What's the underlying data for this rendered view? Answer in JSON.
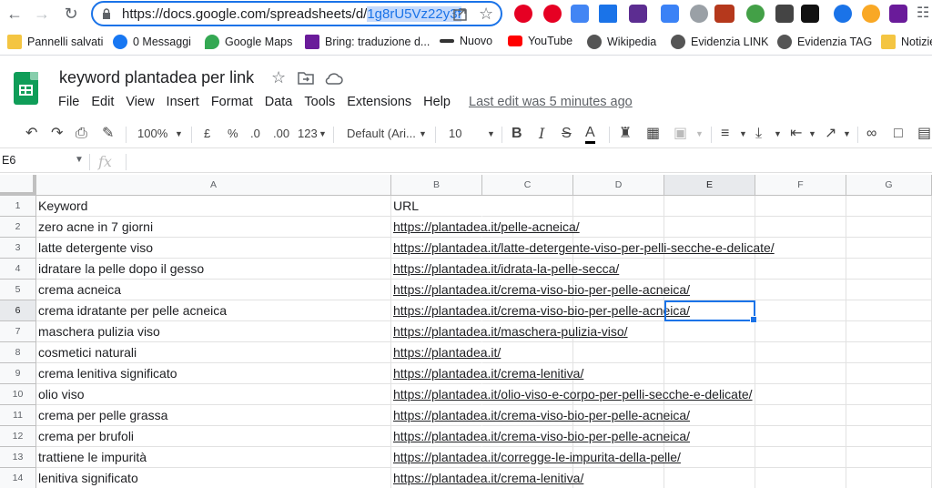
{
  "browser": {
    "url_prefix": "https://docs.google.com/spreadsheets/d/",
    "url_selected": "1g8rU5Vz22y3f"
  },
  "bookmarks": [
    {
      "label": "Pannelli salvati",
      "color": "#f4c542"
    },
    {
      "label": "0 Messaggi",
      "color": "#1877f2"
    },
    {
      "label": "Google Maps",
      "color": "#34a853"
    },
    {
      "label": "Bring: traduzione d...",
      "color": "#6a1b9a"
    },
    {
      "label": "Nuovo",
      "color": "#333333"
    },
    {
      "label": "YouTube",
      "color": "#ff0000"
    },
    {
      "label": "Wikipedia",
      "color": "#555555"
    },
    {
      "label": "Evidenzia LINK",
      "color": "#555555"
    },
    {
      "label": "Evidenzia TAG",
      "color": "#555555"
    },
    {
      "label": "Notizie",
      "color": "#f4c542"
    }
  ],
  "doc": {
    "title": "keyword plantadea per link",
    "last_edit": "Last edit was 5 minutes ago"
  },
  "menu": [
    "File",
    "Edit",
    "View",
    "Insert",
    "Format",
    "Data",
    "Tools",
    "Extensions",
    "Help"
  ],
  "toolbar": {
    "zoom": "100%",
    "currency": "£",
    "percent": "%",
    "dec_less": ".0",
    "dec_more": ".00",
    "more_formats": "123",
    "font": "Default (Ari...",
    "font_size": "10"
  },
  "formula_bar": {
    "name_box": "E6",
    "fx": "fx",
    "value": ""
  },
  "columns": [
    "A",
    "B",
    "C",
    "D",
    "E",
    "F",
    "G"
  ],
  "active_cell": {
    "column": "E",
    "row": 6
  },
  "rows": [
    {
      "n": "1",
      "a": "Keyword",
      "b": "URL",
      "link": false
    },
    {
      "n": "2",
      "a": "zero acne in 7 giorni",
      "b": "https://plantadea.it/pelle-acneica/",
      "link": true
    },
    {
      "n": "3",
      "a": "latte detergente viso",
      "b": "https://plantadea.it/latte-detergente-viso-per-pelli-secche-e-delicate/",
      "link": true
    },
    {
      "n": "4",
      "a": "idratare la pelle dopo il gesso",
      "b": "https://plantadea.it/idrata-la-pelle-secca/",
      "link": true
    },
    {
      "n": "5",
      "a": "crema acneica",
      "b": "https://plantadea.it/crema-viso-bio-per-pelle-acneica/",
      "link": true
    },
    {
      "n": "6",
      "a": "crema idratante per pelle acneica",
      "b": "https://plantadea.it/crema-viso-bio-per-pelle-acneica/",
      "link": true
    },
    {
      "n": "7",
      "a": "maschera pulizia viso",
      "b": "https://plantadea.it/maschera-pulizia-viso/",
      "link": true
    },
    {
      "n": "8",
      "a": "cosmetici naturali",
      "b": "https://plantadea.it/",
      "link": true
    },
    {
      "n": "9",
      "a": "crema lenitiva significato",
      "b": "https://plantadea.it/crema-lenitiva/",
      "link": true
    },
    {
      "n": "10",
      "a": "olio viso",
      "b": "https://plantadea.it/olio-viso-e-corpo-per-pelli-secche-e-delicate/",
      "link": true
    },
    {
      "n": "11",
      "a": "crema per pelle grassa",
      "b": "https://plantadea.it/crema-viso-bio-per-pelle-acneica/",
      "link": true
    },
    {
      "n": "12",
      "a": "crema per brufoli",
      "b": "https://plantadea.it/crema-viso-bio-per-pelle-acneica/",
      "link": true
    },
    {
      "n": "13",
      "a": "trattiene le impurità",
      "b": "https://plantadea.it/corregge-le-impurita-della-pelle/",
      "link": true
    },
    {
      "n": "14",
      "a": "lenitiva significato",
      "b": "https://plantadea.it/crema-lenitiva/",
      "link": true
    }
  ]
}
